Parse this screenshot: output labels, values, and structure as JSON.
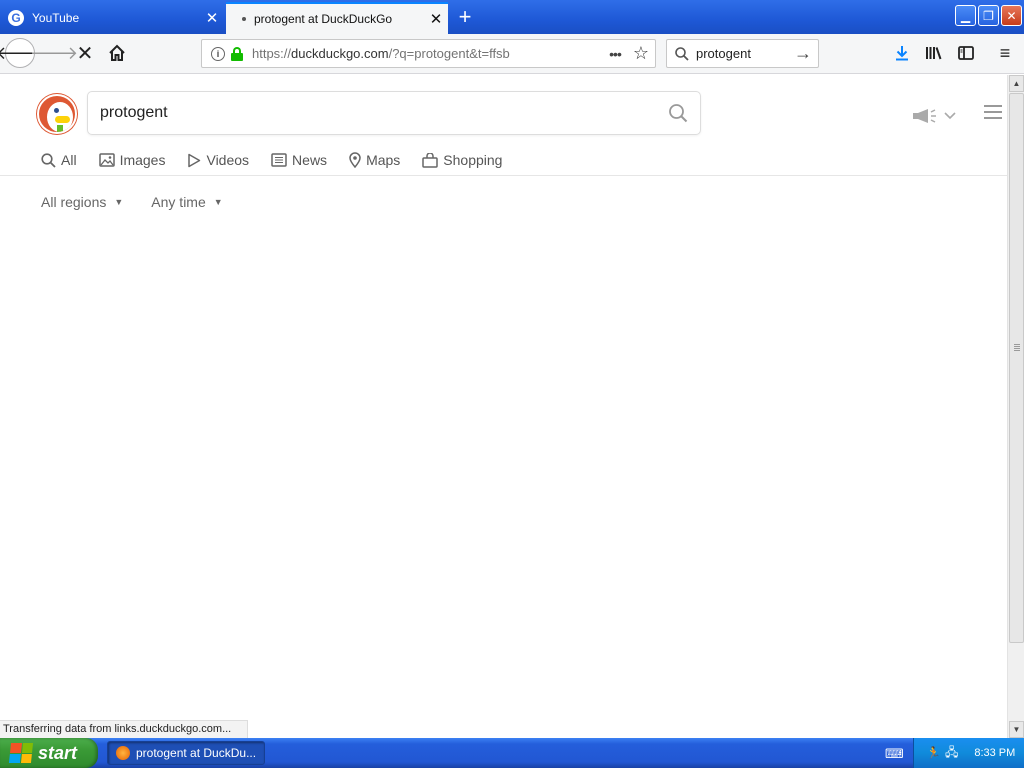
{
  "browser": {
    "tabs": [
      {
        "title": "YouTube",
        "active": false
      },
      {
        "title": "protogent at DuckDuckGo",
        "active": true
      }
    ],
    "url": {
      "prefix": "https://",
      "domain": "duckduckgo.com",
      "path": "/?q=protogent&t=ffsb"
    },
    "search_bar_value": "protogent",
    "status_text": "Transferring data from links.duckduckgo.com..."
  },
  "page": {
    "search_query": "protogent",
    "tabs": [
      {
        "label": "All",
        "icon": "search-icon"
      },
      {
        "label": "Images",
        "icon": "image-icon"
      },
      {
        "label": "Videos",
        "icon": "play-icon"
      },
      {
        "label": "News",
        "icon": "newspaper-icon"
      },
      {
        "label": "Maps",
        "icon": "map-pin-icon"
      },
      {
        "label": "Shopping",
        "icon": "shopping-bag-icon"
      }
    ],
    "filters": [
      {
        "label": "All regions"
      },
      {
        "label": "Any time"
      }
    ]
  },
  "taskbar": {
    "start_label": "start",
    "window_item": "protogent at DuckDu...",
    "clock": "8:33 PM"
  },
  "colors": {
    "ddg_orange": "#de5833",
    "firefox_blue": "#0a84ff",
    "lock_green": "#12bc00"
  }
}
